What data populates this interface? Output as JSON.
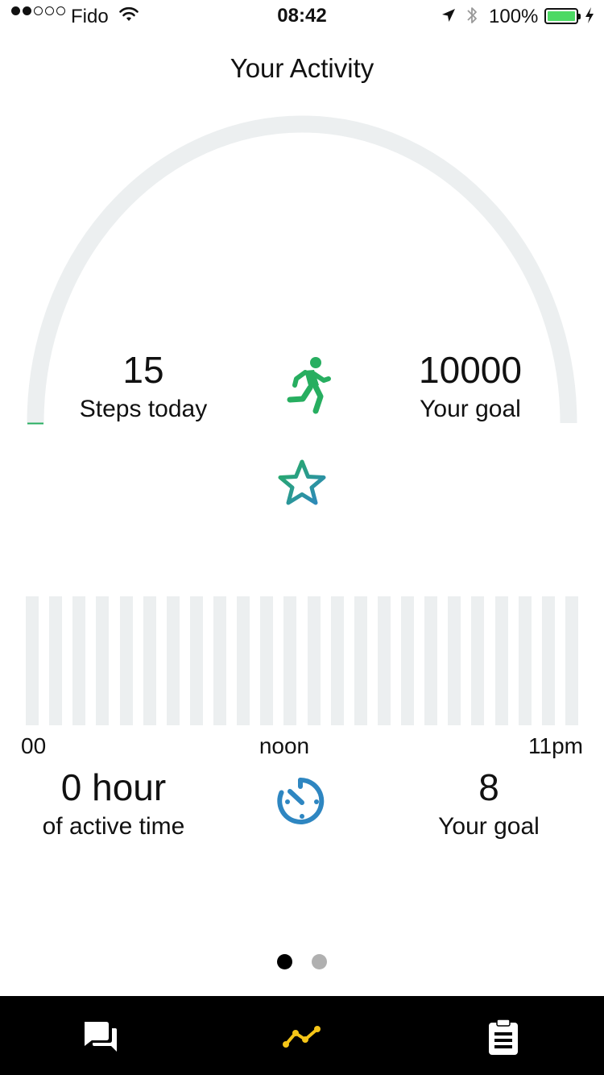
{
  "status_bar": {
    "carrier": "Fido",
    "time": "08:42",
    "battery_percent": "100%",
    "battery_color": "#4cd964"
  },
  "page": {
    "title": "Your Activity"
  },
  "steps": {
    "value": "15",
    "label": "Steps today",
    "goal_value": "10000",
    "goal_label": "Your goal",
    "progress": 0.0015,
    "icon": "running-person-icon",
    "accent": "#27ae60"
  },
  "achievement": {
    "icon": "star-icon"
  },
  "activity_chart": {
    "bar_count": 24,
    "axis_labels": {
      "start": "00",
      "middle": "noon",
      "end": "11pm"
    }
  },
  "active_time": {
    "value": "0 hour",
    "label": "of active time",
    "goal_value": "8",
    "goal_label": "Your goal",
    "icon": "timer-icon",
    "accent": "#2e86c1"
  },
  "pager": {
    "pages": 2,
    "active_index": 0
  },
  "tab_bar": {
    "tabs": [
      {
        "icon": "chat-icon",
        "active": false
      },
      {
        "icon": "activity-graph-icon",
        "active": true
      },
      {
        "icon": "clipboard-icon",
        "active": false
      }
    ],
    "active_color": "#f5c518"
  }
}
